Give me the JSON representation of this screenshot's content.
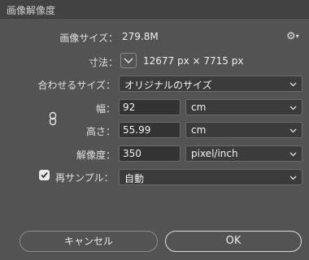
{
  "window": {
    "title": "画像解像度"
  },
  "info": {
    "image_size_label": "画像サイズ：",
    "image_size_value": "279.8M",
    "dimensions_label": "寸法：",
    "dimensions_value": "12677 px × 7715 px"
  },
  "fit_to": {
    "label": "合わせるサイズ：",
    "value": "オリジナルのサイズ"
  },
  "width": {
    "label": "幅：",
    "value": "92",
    "unit": "cm"
  },
  "height": {
    "label": "高さ：",
    "value": "55.99",
    "unit": "cm"
  },
  "resolution": {
    "label": "解像度：",
    "value": "350",
    "unit": "pixel/inch"
  },
  "resample": {
    "label": "再サンプル：",
    "checked": true,
    "value": "自動"
  },
  "buttons": {
    "cancel": "キャンセル",
    "ok": "OK"
  },
  "icons": {
    "settings": "gear-icon",
    "dimensions_toggle": "chevron-down-icon",
    "constrain": "link-icon",
    "dropdown": "chevron-down-icon",
    "check": "checkmark-icon"
  }
}
